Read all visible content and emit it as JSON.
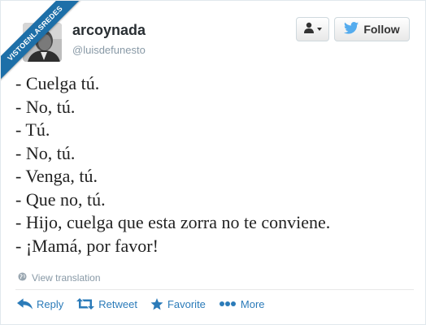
{
  "ribbon": {
    "text": "VISTOENLASREDES"
  },
  "tweet": {
    "user_name": "arcoynada",
    "user_handle": "@luisdefunesto",
    "follow_label": "Follow",
    "lines": [
      "- Cuelga tú.",
      "- No, tú.",
      "- Tú.",
      "- No, tú.",
      "- Venga, tú.",
      "- Que no, tú.",
      "- Hijo, cuelga que esta zorra no te conviene.",
      "- ¡Mamá, por favor!"
    ],
    "translation_label": "View translation"
  },
  "actions": {
    "reply": "Reply",
    "retweet": "Retweet",
    "favorite": "Favorite",
    "more": "More"
  },
  "icons": {
    "user_menu": "user-menu-icon",
    "bird": "twitter-bird-icon",
    "globe": "globe-icon",
    "reply": "reply-arrow-icon",
    "retweet": "retweet-icon",
    "favorite": "star-icon",
    "more": "more-dots-icon"
  },
  "colors": {
    "link": "#2b7bb9",
    "bird": "#55acee",
    "ribbon": "#1d6fa8",
    "muted": "#8899a6"
  }
}
